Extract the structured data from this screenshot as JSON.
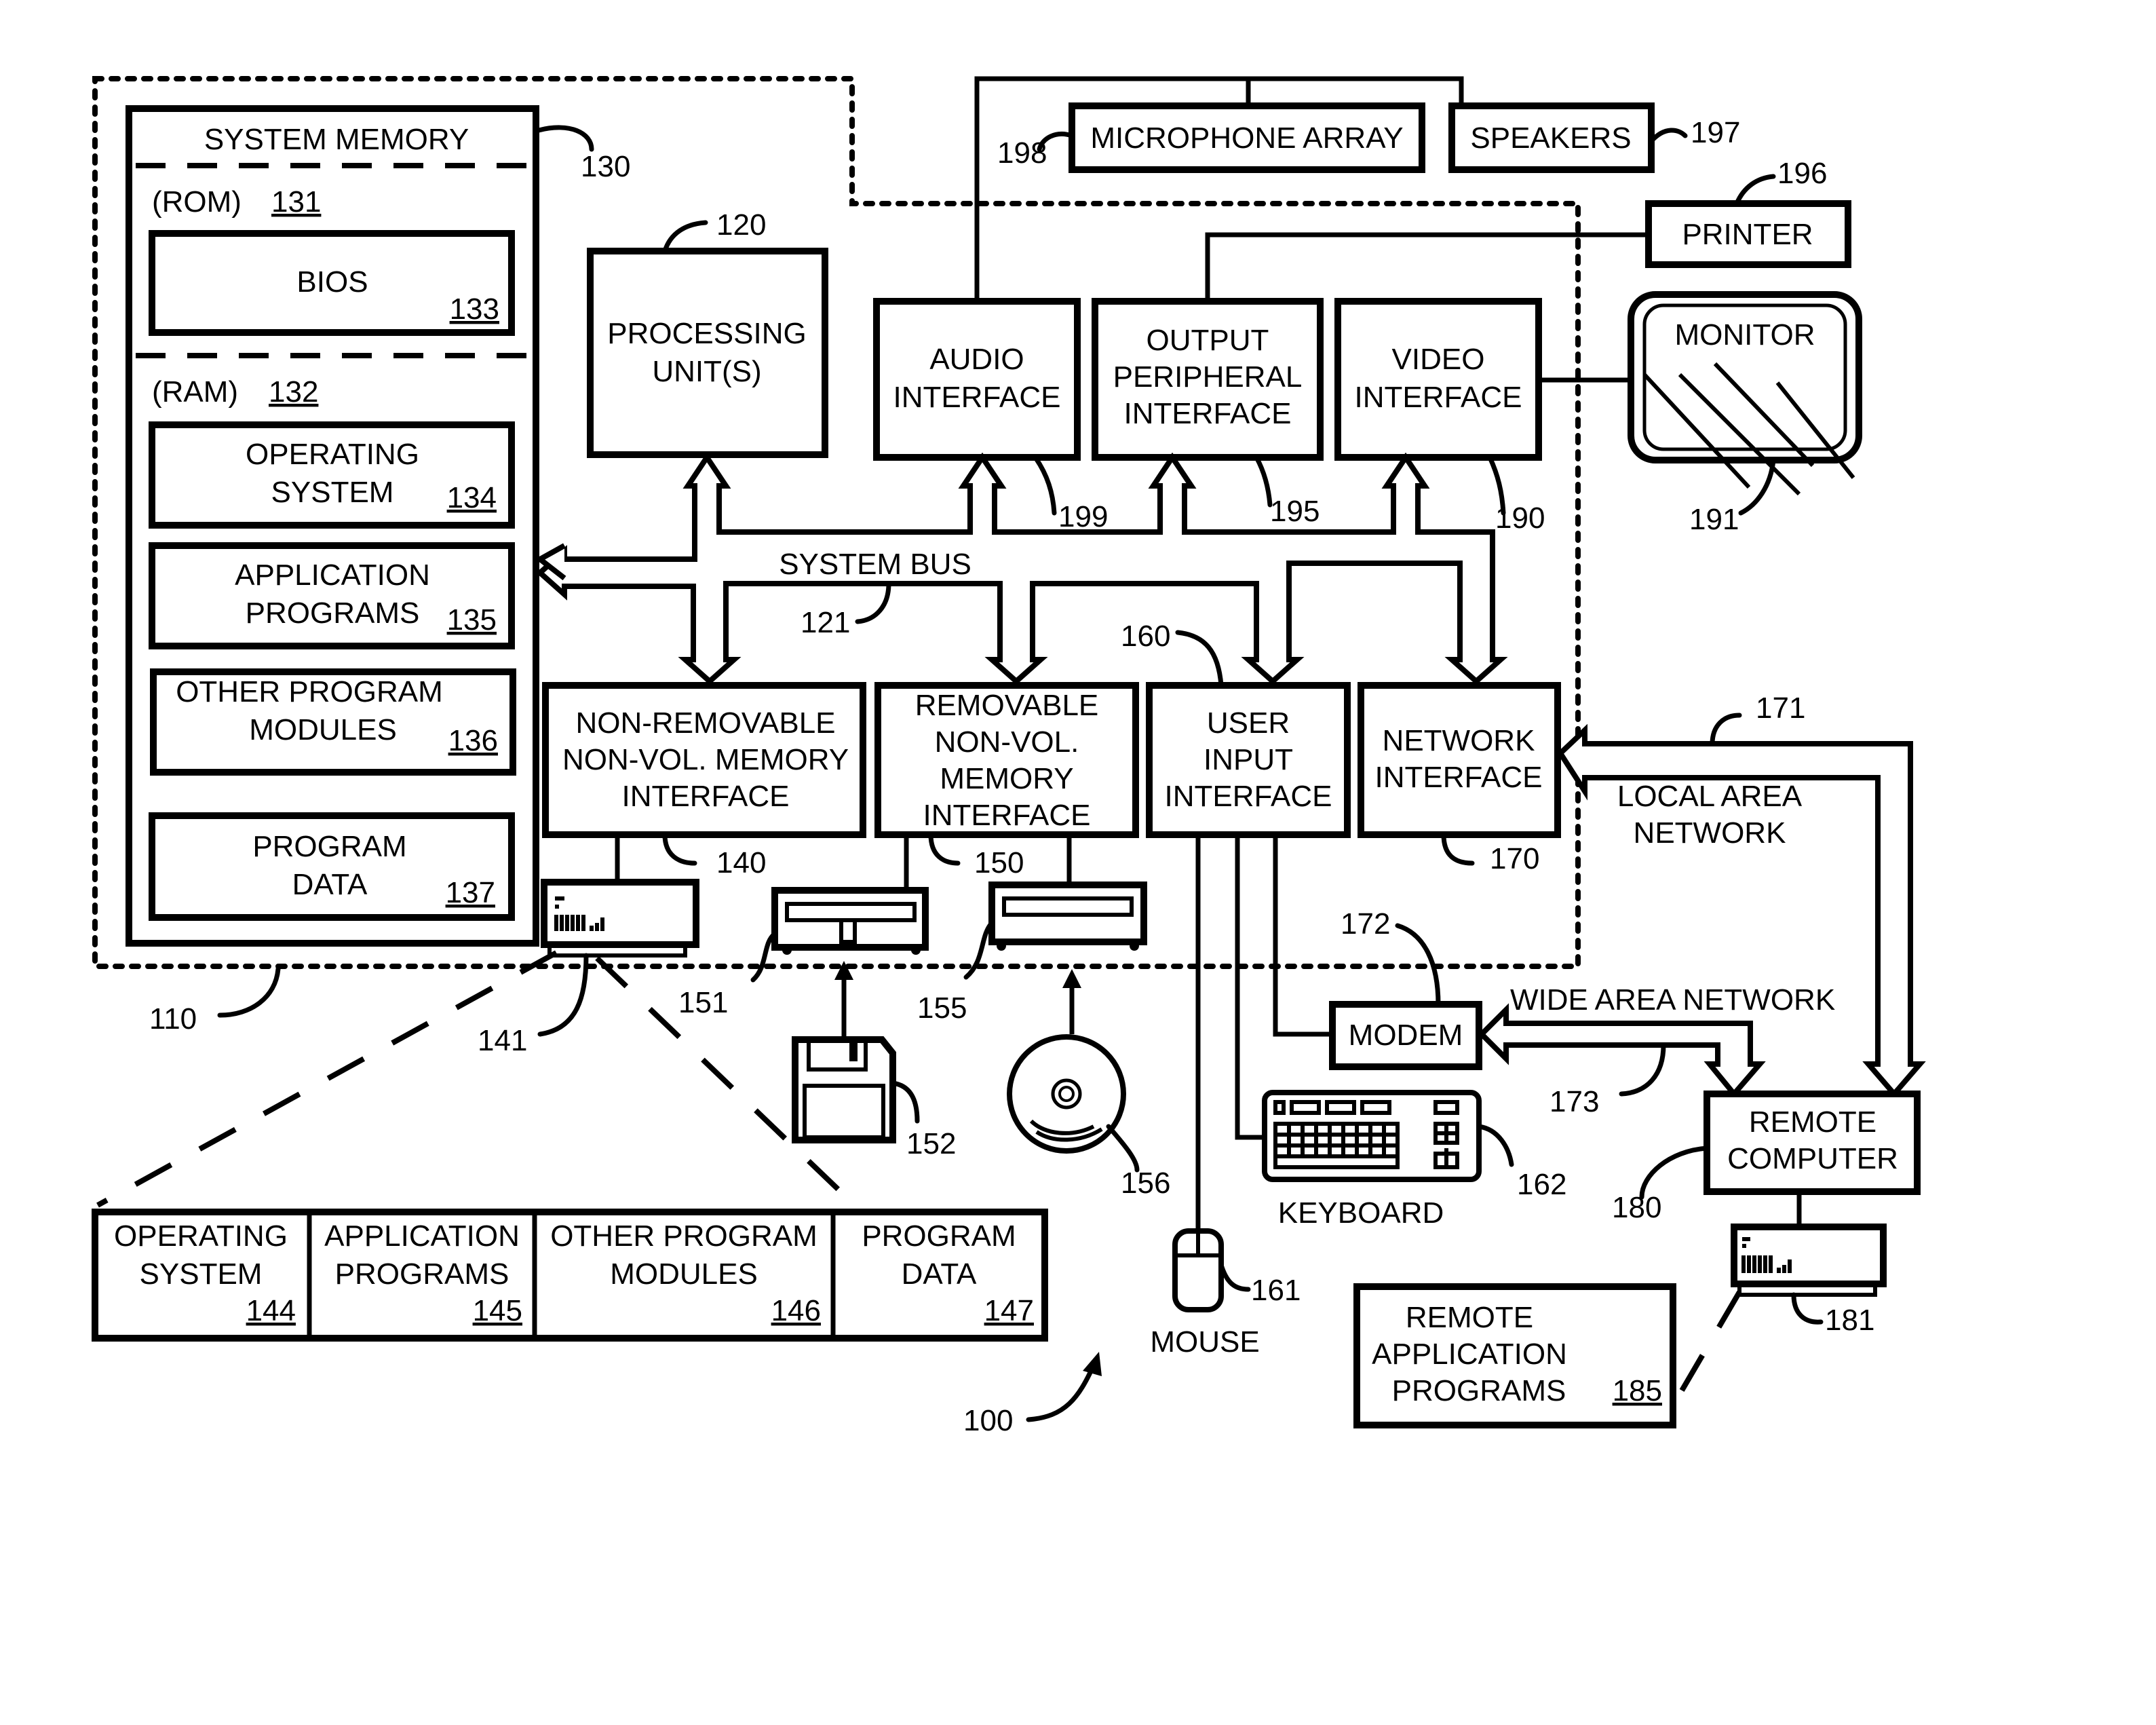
{
  "figure_number": "100",
  "computer": {
    "ref": "110"
  },
  "system_memory": {
    "title": "SYSTEM MEMORY",
    "ref": "130",
    "rom": {
      "label": "(ROM)",
      "ref": "131"
    },
    "ram": {
      "label": "(RAM)",
      "ref": "132"
    },
    "bios": {
      "label": "BIOS",
      "ref": "133"
    },
    "os": {
      "line1": "OPERATING",
      "line2": "SYSTEM",
      "ref": "134"
    },
    "apps": {
      "line1": "APPLICATION",
      "line2": "PROGRAMS",
      "ref": "135"
    },
    "modules": {
      "line1": "OTHER PROGRAM",
      "line2": "MODULES",
      "ref": "136"
    },
    "data": {
      "line1": "PROGRAM",
      "line2": "DATA",
      "ref": "137"
    }
  },
  "processing_unit": {
    "line1": "PROCESSING",
    "line2": "UNIT(S)",
    "ref": "120"
  },
  "system_bus": {
    "label": "SYSTEM BUS",
    "ref": "121"
  },
  "audio_interface": {
    "line1": "AUDIO",
    "line2": "INTERFACE",
    "ref": "199"
  },
  "output_peripheral_interface": {
    "line1": "OUTPUT",
    "line2": "PERIPHERAL",
    "line3": "INTERFACE",
    "ref": "195"
  },
  "video_interface": {
    "line1": "VIDEO",
    "line2": "INTERFACE",
    "ref": "190"
  },
  "microphone_array": {
    "label": "MICROPHONE ARRAY",
    "ref": "198"
  },
  "speakers": {
    "label": "SPEAKERS",
    "ref": "197"
  },
  "printer": {
    "label": "PRINTER",
    "ref": "196"
  },
  "monitor": {
    "label": "MONITOR",
    "ref": "191"
  },
  "non_removable_interface": {
    "line1": "NON-REMOVABLE",
    "line2": "NON-VOL. MEMORY",
    "line3": "INTERFACE",
    "ref": "140"
  },
  "removable_interface": {
    "line1": "REMOVABLE",
    "line2": "NON-VOL.",
    "line3": "MEMORY",
    "line4": "INTERFACE",
    "ref": "150"
  },
  "user_input_interface": {
    "line1": "USER",
    "line2": "INPUT",
    "line3": "INTERFACE",
    "ref": "160"
  },
  "network_interface": {
    "line1": "NETWORK",
    "line2": "INTERFACE",
    "ref": "170"
  },
  "hard_disk": {
    "ref": "141"
  },
  "floppy_drive": {
    "ref": "151"
  },
  "floppy_disk": {
    "ref": "152"
  },
  "optical_drive": {
    "ref": "155"
  },
  "optical_disk": {
    "ref": "156"
  },
  "lan": {
    "line1": "LOCAL AREA",
    "line2": "NETWORK",
    "ref": "171"
  },
  "wan": {
    "label": "WIDE AREA NETWORK",
    "ref": "173"
  },
  "modem": {
    "label": "MODEM",
    "ref": "172"
  },
  "keyboard": {
    "label": "KEYBOARD",
    "ref": "162"
  },
  "mouse": {
    "label": "MOUSE",
    "ref": "161"
  },
  "remote_computer": {
    "line1": "REMOTE",
    "line2": "COMPUTER",
    "ref": "180"
  },
  "remote_disk": {
    "ref": "181"
  },
  "remote_apps": {
    "line1": "REMOTE",
    "line2": "APPLICATION",
    "line3": "PROGRAMS",
    "ref": "185"
  },
  "disk_contents": [
    {
      "line1": "OPERATING",
      "line2": "SYSTEM",
      "ref": "144"
    },
    {
      "line1": "APPLICATION",
      "line2": "PROGRAMS",
      "ref": "145"
    },
    {
      "line1": "OTHER PROGRAM",
      "line2": "MODULES",
      "ref": "146"
    },
    {
      "line1": "PROGRAM",
      "line2": "DATA",
      "ref": "147"
    }
  ]
}
